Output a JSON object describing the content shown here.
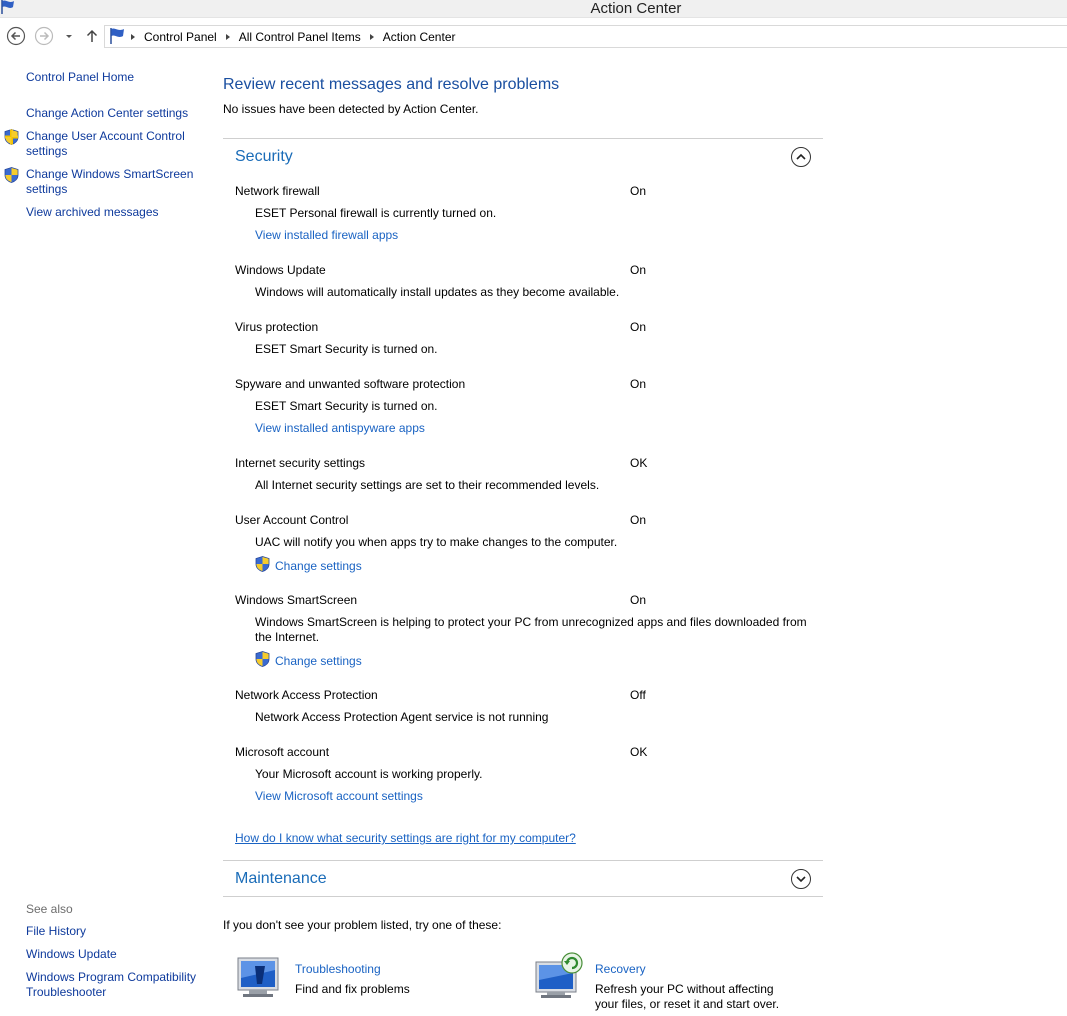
{
  "window": {
    "title": "Action Center"
  },
  "nav": {
    "breadcrumbs": [
      "Control Panel",
      "All Control Panel Items",
      "Action Center"
    ]
  },
  "left_pane": {
    "links": [
      "Control Panel Home",
      "Change Action Center settings",
      "Change User Account Control settings",
      "Change Windows SmartScreen settings",
      "View archived messages"
    ],
    "see_also_title": "See also",
    "see_also": [
      "File History",
      "Windows Update",
      "Windows Program Compatibility Troubleshooter"
    ]
  },
  "main": {
    "title": "Review recent messages and resolve problems",
    "subtitle": "No issues have been detected by Action Center.",
    "security": {
      "title": "Security",
      "items": [
        {
          "name": "Network firewall",
          "status": "On",
          "desc": "ESET Personal firewall is currently turned on.",
          "link": "View installed firewall apps"
        },
        {
          "name": "Windows Update",
          "status": "On",
          "desc": "Windows will automatically install updates as they become available."
        },
        {
          "name": "Virus protection",
          "status": "On",
          "desc": "ESET Smart Security is turned on."
        },
        {
          "name": "Spyware and unwanted software protection",
          "status": "On",
          "desc": "ESET Smart Security is turned on.",
          "link": "View installed antispyware apps"
        },
        {
          "name": "Internet security settings",
          "status": "OK",
          "desc": "All Internet security settings are set to their recommended levels."
        },
        {
          "name": "User Account Control",
          "status": "On",
          "desc": "UAC will notify you when apps try to make changes to the computer.",
          "link": "Change settings"
        },
        {
          "name": "Windows SmartScreen",
          "status": "On",
          "desc": "Windows SmartScreen is helping to protect your PC from unrecognized apps and files downloaded from the Internet.",
          "link": "Change settings"
        },
        {
          "name": "Network Access Protection",
          "status": "Off",
          "desc": "Network Access Protection Agent service is not running"
        },
        {
          "name": "Microsoft account",
          "status": "OK",
          "desc": "Your Microsoft account is working properly.",
          "link": "View Microsoft account settings"
        }
      ],
      "help_link": "How do I know what security settings are right for my computer?"
    },
    "maintenance": {
      "title": "Maintenance"
    },
    "try_text": "If you don't see your problem listed, try one of these:",
    "tools": [
      {
        "title": "Troubleshooting",
        "desc": "Find and fix problems"
      },
      {
        "title": "Recovery",
        "desc": "Refresh your PC without affecting your files, or reset it and start over."
      }
    ]
  }
}
